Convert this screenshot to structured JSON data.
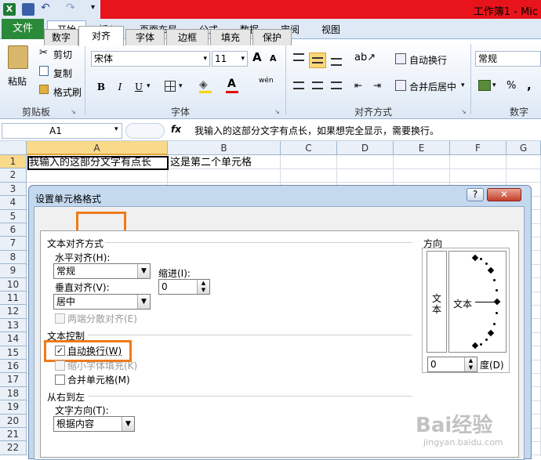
{
  "window": {
    "title": "工作簿1 - Mic"
  },
  "ribbon_tabs": {
    "file": "文件",
    "home": "开始",
    "insert": "插入",
    "layout": "页面布局",
    "formulas": "公式",
    "data": "数据",
    "review": "审阅",
    "view": "视图"
  },
  "clipboard": {
    "paste": "粘贴",
    "cut": "剪切",
    "copy": "复制",
    "painter": "格式刷",
    "label": "剪贴板"
  },
  "font": {
    "name": "宋体",
    "size": "11",
    "bold": "B",
    "italic": "I",
    "underline": "U",
    "label": "字体",
    "grow": "A",
    "shrink": "A",
    "color_letter": "A",
    "phonetic": "wén"
  },
  "alignment": {
    "wrap": "自动换行",
    "merge": "合并后居中",
    "label": "对齐方式"
  },
  "number": {
    "format": "常规",
    "percent": "%",
    "comma": ",",
    "label": "数字"
  },
  "formula_bar": {
    "name_box": "A1",
    "fx": "fx",
    "content": "我输入的这部分文字有点长，如果想完全显示，需要换行。"
  },
  "columns": [
    "A",
    "B",
    "C",
    "D",
    "E",
    "F",
    "G"
  ],
  "rows": [
    "1",
    "2",
    "3",
    "4",
    "5",
    "6",
    "7",
    "8",
    "9",
    "10",
    "11",
    "12",
    "13",
    "14",
    "15",
    "16",
    "17",
    "18",
    "19",
    "20",
    "21",
    "22"
  ],
  "cells": {
    "A1": "我输入的这部分文字有点长",
    "B1": "这是第二个单元格"
  },
  "dialog": {
    "title": "设置单元格格式",
    "help": "?",
    "close": "✕",
    "tabs": [
      "数字",
      "对齐",
      "字体",
      "边框",
      "填充",
      "保护"
    ],
    "text_align_section": "文本对齐方式",
    "horizontal_label": "水平对齐(H):",
    "horizontal_value": "常规",
    "indent_label": "缩进(I):",
    "indent_value": "0",
    "vertical_label": "垂直对齐(V):",
    "vertical_value": "居中",
    "distributed": "两端分散对齐(E)",
    "text_control_section": "文本控制",
    "wrap_text": "自动换行(W)",
    "shrink_to_fit": "缩小字体填充(K)",
    "merge_cells": "合并单元格(M)",
    "rtl_section": "从右到左",
    "text_direction_label": "文字方向(T):",
    "text_direction_value": "根据内容",
    "orientation_section": "方向",
    "vertical_text": "文本",
    "orientation_text": "文本",
    "degrees_value": "0",
    "degrees_label": "度(D)"
  },
  "watermark": {
    "text": "Bai经验",
    "sub": "jingyan.baidu.com"
  },
  "colors": {
    "accent_green": "#2a8a3a",
    "title_red": "#e8141b",
    "highlight": "#f07a1a"
  }
}
